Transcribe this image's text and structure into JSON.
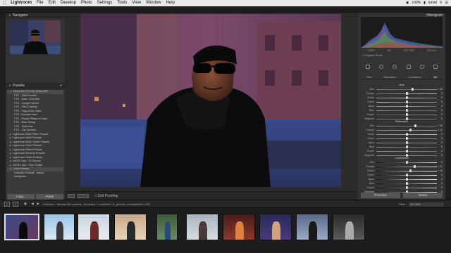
{
  "menubar": {
    "app": "Lightroom",
    "items": [
      "File",
      "Edit",
      "Develop",
      "Photo",
      "Settings",
      "Tools",
      "View",
      "Window",
      "Help"
    ],
    "battery": "100%",
    "user": "tutvid"
  },
  "left_panel": {
    "navigator_title": "Navigator",
    "presets_title": "Presets",
    "presets": [
      {
        "label": "FAMOUS TUTVID EMULATE",
        "level": 0,
        "open": true
      },
      {
        "label": "FTE - 28th Parallel",
        "level": 1
      },
      {
        "label": "FTE - Amer. Civil War",
        "level": 1
      },
      {
        "label": "FTE - Conger Gentle",
        "level": 1
      },
      {
        "label": "FTE - Film Cowboy",
        "level": 1
      },
      {
        "label": "FTE - Flag of Iwo Jima",
        "level": 1
      },
      {
        "label": "FTE - Monster Man",
        "level": 1
      },
      {
        "label": "FTE - Purple Pillars of Crea...",
        "level": 1
      },
      {
        "label": "FTE - Raw Stomp",
        "level": 1
      },
      {
        "label": "FTE - Tank Man",
        "level": 1
      },
      {
        "label": "FTE - The Woman",
        "level": 1
      },
      {
        "label": "Lightroom B&W Filter Presets",
        "level": 0
      },
      {
        "label": "Lightroom B&W Presets",
        "level": 0
      },
      {
        "label": "Lightroom B&W Toned Presets",
        "level": 0
      },
      {
        "label": "Lightroom Color Presets",
        "level": 0
      },
      {
        "label": "Lightroom Effect Presets",
        "level": 0
      },
      {
        "label": "Lightroom General Presets",
        "level": 0
      },
      {
        "label": "Lightroom Video Presets",
        "level": 0
      },
      {
        "label": "NATE Cam - E Chrome",
        "level": 0
      },
      {
        "label": "NATE Cam - Film Toolkit",
        "level": 0
      },
      {
        "label": "User Presets",
        "level": 0,
        "open": true
      },
      {
        "label": "Dramatic Portrait - Indoor",
        "level": 1
      },
      {
        "label": "Instagram",
        "level": 1
      }
    ],
    "snapshots_title": "Snapshots",
    "copy_label": "Copy...",
    "paste_label": "Paste"
  },
  "toolbar": {
    "soft_proofing": "Soft Proofing"
  },
  "right_panel": {
    "histogram_title": "Histogram",
    "histogram_info": [
      "1/500",
      "f/4",
      "ISO 100",
      "50 mm"
    ],
    "original_photo": "Original Photo",
    "hsl_tabs": [
      "Hue",
      "Saturation",
      "Luminance",
      "All"
    ],
    "active_tab": "All",
    "groups": [
      {
        "title": "Hue",
        "sliders": [
          {
            "label": "Red",
            "value": "+ 20",
            "pos": 0.6
          },
          {
            "label": "Orange",
            "value": "0",
            "pos": 0.5
          },
          {
            "label": "Yellow",
            "value": "0",
            "pos": 0.5
          },
          {
            "label": "Green",
            "value": "0",
            "pos": 0.5
          },
          {
            "label": "Aqua",
            "value": "0",
            "pos": 0.5
          },
          {
            "label": "Blue",
            "value": "0",
            "pos": 0.5
          },
          {
            "label": "Purple",
            "value": "0",
            "pos": 0.5
          },
          {
            "label": "Magenta",
            "value": "0",
            "pos": 0.5
          }
        ]
      },
      {
        "title": "Saturation",
        "sliders": [
          {
            "label": "Red",
            "value": "+ 30",
            "pos": 0.65
          },
          {
            "label": "Orange",
            "value": "+ 11",
            "pos": 0.56
          },
          {
            "label": "Yellow",
            "value": "0",
            "pos": 0.5
          },
          {
            "label": "Green",
            "value": "0",
            "pos": 0.5
          },
          {
            "label": "Aqua",
            "value": "0",
            "pos": 0.5
          },
          {
            "label": "Blue",
            "value": "0",
            "pos": 0.5
          },
          {
            "label": "Purple",
            "value": "0",
            "pos": 0.5
          },
          {
            "label": "Magenta",
            "value": "0",
            "pos": 0.5
          }
        ]
      },
      {
        "title": "Luminance",
        "sliders": [
          {
            "label": "Red",
            "value": "0",
            "pos": 0.5
          },
          {
            "label": "Orange",
            "value": "+ 27",
            "pos": 0.63
          },
          {
            "label": "Yellow",
            "value": "+ 13",
            "pos": 0.56
          },
          {
            "label": "Green",
            "value": "0",
            "pos": 0.5
          },
          {
            "label": "Aqua",
            "value": "0",
            "pos": 0.5
          },
          {
            "label": "Blue",
            "value": "0",
            "pos": 0.5
          },
          {
            "label": "Purple",
            "value": "0",
            "pos": 0.5
          },
          {
            "label": "Magenta",
            "value": "0",
            "pos": 0.5
          }
        ]
      }
    ],
    "previous_label": "Previous",
    "reset_label": "Reset"
  },
  "filmbar": {
    "page1": "1",
    "page2": "2",
    "collection": "Collection : famous film presets",
    "count": "10 photos / 1 selected / fr_presets_examples001.CR2",
    "filter_label": "Filter :",
    "filter_value": "No Filter"
  },
  "filmstrip": {
    "count": 10,
    "selected_index": 0
  }
}
